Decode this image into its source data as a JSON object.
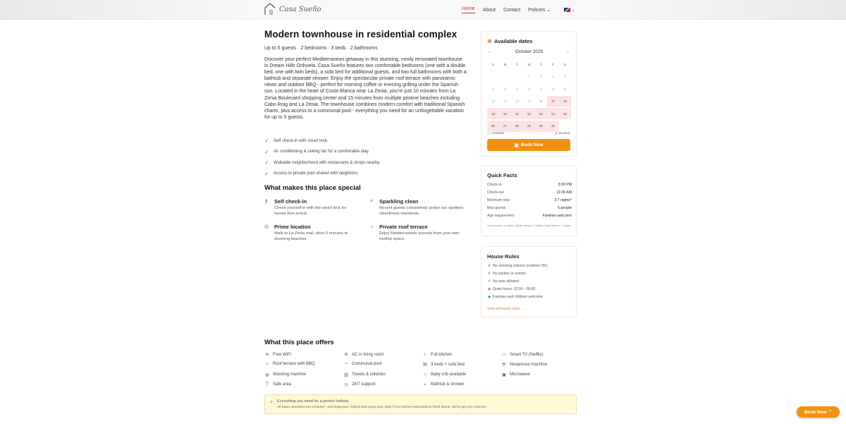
{
  "brand": {
    "logo_text": "Casa Sueño"
  },
  "nav": {
    "items": [
      {
        "label": "Home",
        "active": true
      },
      {
        "label": "About"
      },
      {
        "label": "Contact"
      },
      {
        "label": "Policies ⌄"
      }
    ],
    "lang_caret": "⌄"
  },
  "listing": {
    "title": "Modern townhouse in residential complex",
    "subtitle": "Up to 5 guests · 2 bedrooms · 3 beds · 2 bathrooms",
    "description": "Discover your perfect Mediterranean getaway in this stunning, newly renovated townhouse in Dream Hills Orihuela. Casa Sueño features two comfortable bedrooms (one with a double bed, one with twin beds), a sofa bed for additional guests, and two full bathrooms with both a bathtub and separate shower. Enjoy the spectacular private roof terrace with panoramic views and outdoor BBQ - perfect for morning coffee or evening grilling under the Spanish sun. Located in the heart of Costa Blanca near La Zenia, you're just 10 minutes from La Zenia Boulevard shopping center and 15 minutes from multiple pristine beaches including Cabo Roig and La Zenia. The townhouse combines modern comfort with traditional Spanish charm, plus access to a communal pool - everything you need for an unforgettable vacation for up to 5 guests.",
    "features": [
      "Self check-in with smart lock.",
      "Air conditioning & ceiling fan for a comfortable stay.",
      "Walkable neighborhood with restaurants & shops nearby.",
      "Access to private pool shared with neighbors."
    ]
  },
  "special": {
    "heading": "What makes this place special",
    "items": [
      {
        "title": "Self check-in",
        "desc": "Check yourself in with the smart lock for hassle-free arrival.",
        "icon": "key-icon"
      },
      {
        "title": "Sparkling clean",
        "desc": "Recent guests consistently praise our spotless cleanliness standards.",
        "icon": "sparkle-icon"
      },
      {
        "title": "Prime location",
        "desc": "Walk to La Zenia mall, drive 5 minutes to stunning beaches.",
        "icon": "location-icon"
      },
      {
        "title": "Private roof terrace",
        "desc": "Enjoy Mediterranean sunsets from your own rooftop space.",
        "icon": "sun-icon"
      }
    ]
  },
  "availability": {
    "title": "Available dates",
    "month": "October 2025",
    "weekdays": [
      "S",
      "M",
      "T",
      "W",
      "T",
      "F",
      "S"
    ],
    "weeks": [
      [
        "",
        "",
        "",
        "1",
        "2",
        "3",
        "4"
      ],
      [
        "5",
        "6",
        "7",
        "8",
        "9",
        "10",
        "11"
      ],
      [
        "12",
        "13",
        "14",
        "15",
        "16",
        "17",
        "18"
      ],
      [
        "19",
        "20",
        "21",
        "22",
        "23",
        "24",
        "25"
      ],
      [
        "26",
        "27",
        "28",
        "29",
        "30",
        "31",
        ""
      ]
    ],
    "available_days": [
      "17",
      "18",
      "19",
      "20",
      "21",
      "22",
      "23",
      "24",
      "25",
      "26",
      "27",
      "28",
      "29",
      "30",
      "31"
    ],
    "legend_available": "Available",
    "legend_booked": "Booked",
    "book_button": "Book Now"
  },
  "quick_facts": {
    "title": "Quick Facts",
    "rows": [
      {
        "label": "Check-in",
        "value": "3:00 PM"
      },
      {
        "label": "Check-out",
        "value": "11:00 AM"
      },
      {
        "label": "Minimum stay",
        "value": "3-7 nights*"
      },
      {
        "label": "Max guests",
        "value": "5 people"
      },
      {
        "label": "Age requirement",
        "value": "Families welcome"
      }
    ],
    "note": "*Low season: 3 nights, Middle season: 4 nights, High season: 7 nights"
  },
  "house_rules": {
    "title": "House Rules",
    "rules": [
      {
        "text": "No smoking indoors (outdoor OK)",
        "icon": "x-icon",
        "color": "#d9534f"
      },
      {
        "text": "No parties or events",
        "icon": "x-icon",
        "color": "#d9534f"
      },
      {
        "text": "No pets allowed",
        "icon": "x-icon",
        "color": "#d9534f"
      },
      {
        "text": "Quiet hours: 22:00 - 08:00",
        "icon": "clock-icon",
        "color": "#d9534f"
      },
      {
        "text": "Families and children welcome",
        "icon": "diamond-icon",
        "color": "#3a7bd5"
      }
    ],
    "link": "View all house rules →"
  },
  "offers": {
    "heading": "What this place offers",
    "items": [
      {
        "label": "Free WiFi",
        "icon": "wifi-icon"
      },
      {
        "label": "AC in living room",
        "icon": "ac-icon"
      },
      {
        "label": "Full kitchen",
        "icon": "kitchen-icon"
      },
      {
        "label": "Smart TV (Netflix)",
        "icon": "tv-icon"
      },
      {
        "label": "Roof terrace with BBQ",
        "icon": "sun-icon"
      },
      {
        "label": "Communal pool",
        "icon": "pool-icon"
      },
      {
        "label": "3 beds + sofa bed",
        "icon": "bed-icon"
      },
      {
        "label": "Nespresso machine",
        "icon": "coffee-icon"
      },
      {
        "label": "Washing machine",
        "icon": "washer-icon"
      },
      {
        "label": "Towels & toiletries",
        "icon": "towel-icon"
      },
      {
        "label": "Baby crib available",
        "icon": "crib-icon"
      },
      {
        "label": "Microwave",
        "icon": "microwave-icon"
      },
      {
        "label": "Safe area",
        "icon": "shield-icon"
      },
      {
        "label": "24/7 support",
        "icon": "support-icon"
      },
      {
        "label": "Bathtub & shower",
        "icon": "bath-icon"
      }
    ]
  },
  "banner": {
    "line1": "Everything you need for a perfect holiday",
    "line2": "All basic amenities are included - just bring your clothes and enjoy your stay! From kitchen essentials to fresh linens, we've got you covered."
  },
  "floating_button": {
    "label": "Book Now ⌃"
  },
  "colors": {
    "accent": "#f29110",
    "available": "#fde4e4",
    "check": "#2e9e4a"
  }
}
